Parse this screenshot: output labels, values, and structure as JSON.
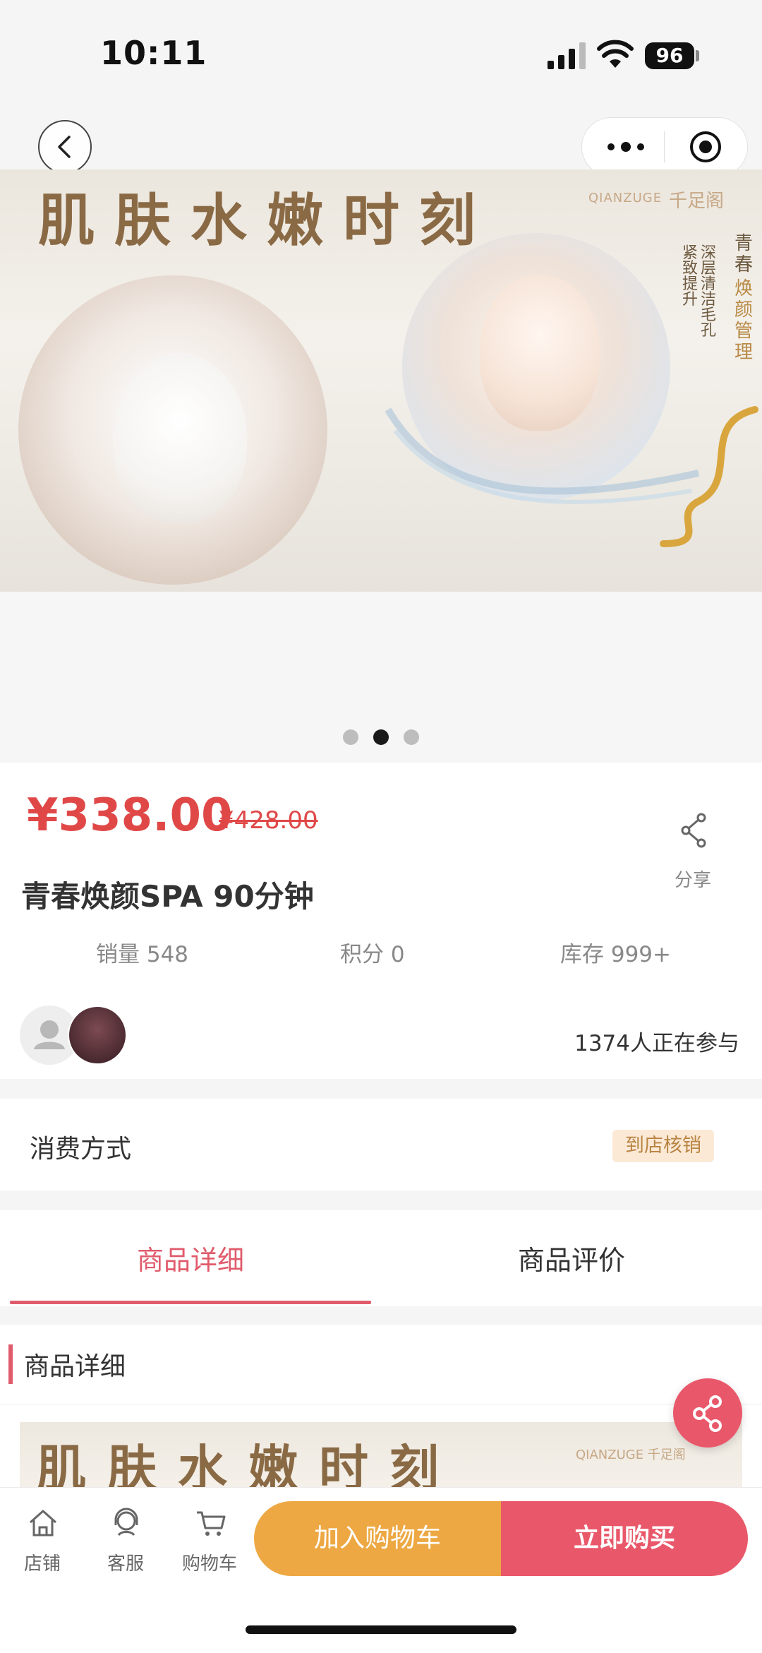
{
  "status_bar": {
    "time": "10:11",
    "battery": "96"
  },
  "banner": {
    "title": "肌肤水嫩时刻",
    "brand_en": "QIANZUGE",
    "brand_cn": "千足阁",
    "side_text_1": "深层清洁毛孔",
    "side_text_2": "紧致提升",
    "side_text_gold_top": "青春",
    "side_text_gold": "焕颜管理",
    "page_count": 3,
    "active_page": 2
  },
  "product": {
    "price": "¥338.00",
    "original_price": "¥428.00",
    "title": "青春焕颜SPA 90分钟",
    "share_label": "分享",
    "stats": {
      "sales": "销量 548",
      "points": "积分 0",
      "stock": "库存 999+"
    },
    "participants": "1374人正在参与"
  },
  "consumption": {
    "label": "消费方式",
    "badge": "到店核销"
  },
  "tabs": {
    "detail": "商品详细",
    "reviews": "商品评价"
  },
  "detail_section": {
    "heading": "商品详细",
    "banner_title": "肌肤水嫩时刻",
    "banner_brand": "QIANZUGE 千足阁"
  },
  "bottom_bar": {
    "store": "店铺",
    "service": "客服",
    "cart": "购物车",
    "add_to_cart": "加入购物车",
    "buy_now": "立即购买"
  }
}
